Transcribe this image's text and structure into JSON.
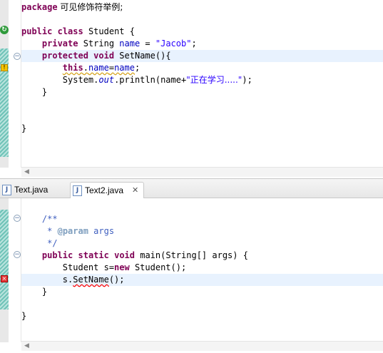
{
  "top_editor": {
    "line1_kw": "package",
    "line1_rest": " 可见修饰符举例;",
    "class_kw1": "public",
    "class_kw2": "class",
    "class_name": " Student {",
    "field_kw": "private",
    "field_type": " String ",
    "field_name": "name",
    "field_eq": " = ",
    "field_value": "\"Jacob\"",
    "field_end": ";",
    "method_kw1": "protected",
    "method_kw2": "void",
    "method_sig": " SetName(){",
    "this_kw": "this",
    "this_dot": ".",
    "this_field": "name",
    "this_eq": "=",
    "this_var": "name",
    "this_end": ";",
    "print_prefix": "System.",
    "print_out": "out",
    "print_call": ".println(name+",
    "print_str": "\"正在学习.....\"",
    "print_end": ");",
    "close_method": "}",
    "close_class": "}",
    "override_icon": "override-icon",
    "warning_icon": "warning-marker-icon"
  },
  "tabs": [
    {
      "label": "Text.java",
      "icon": "java-file-icon"
    },
    {
      "label": "Text2.java",
      "icon": "java-file-icon",
      "active": true,
      "close_glyph": "✕"
    }
  ],
  "bottom_editor": {
    "doc_open": "/**",
    "doc_star": " * ",
    "doc_tag": "@param",
    "doc_param": " args",
    "doc_close": " */",
    "main_kw1": "public",
    "main_kw2": "static",
    "main_kw3": "void",
    "main_sig": " main(String[] args) {",
    "decl_type": "Student s=",
    "decl_new": "new",
    "decl_rest": " Student();",
    "call_obj": "s.",
    "call_method": "SetName",
    "call_end": "();",
    "close_method": "}",
    "close_class": "}",
    "error_icon": "error-marker-icon"
  }
}
